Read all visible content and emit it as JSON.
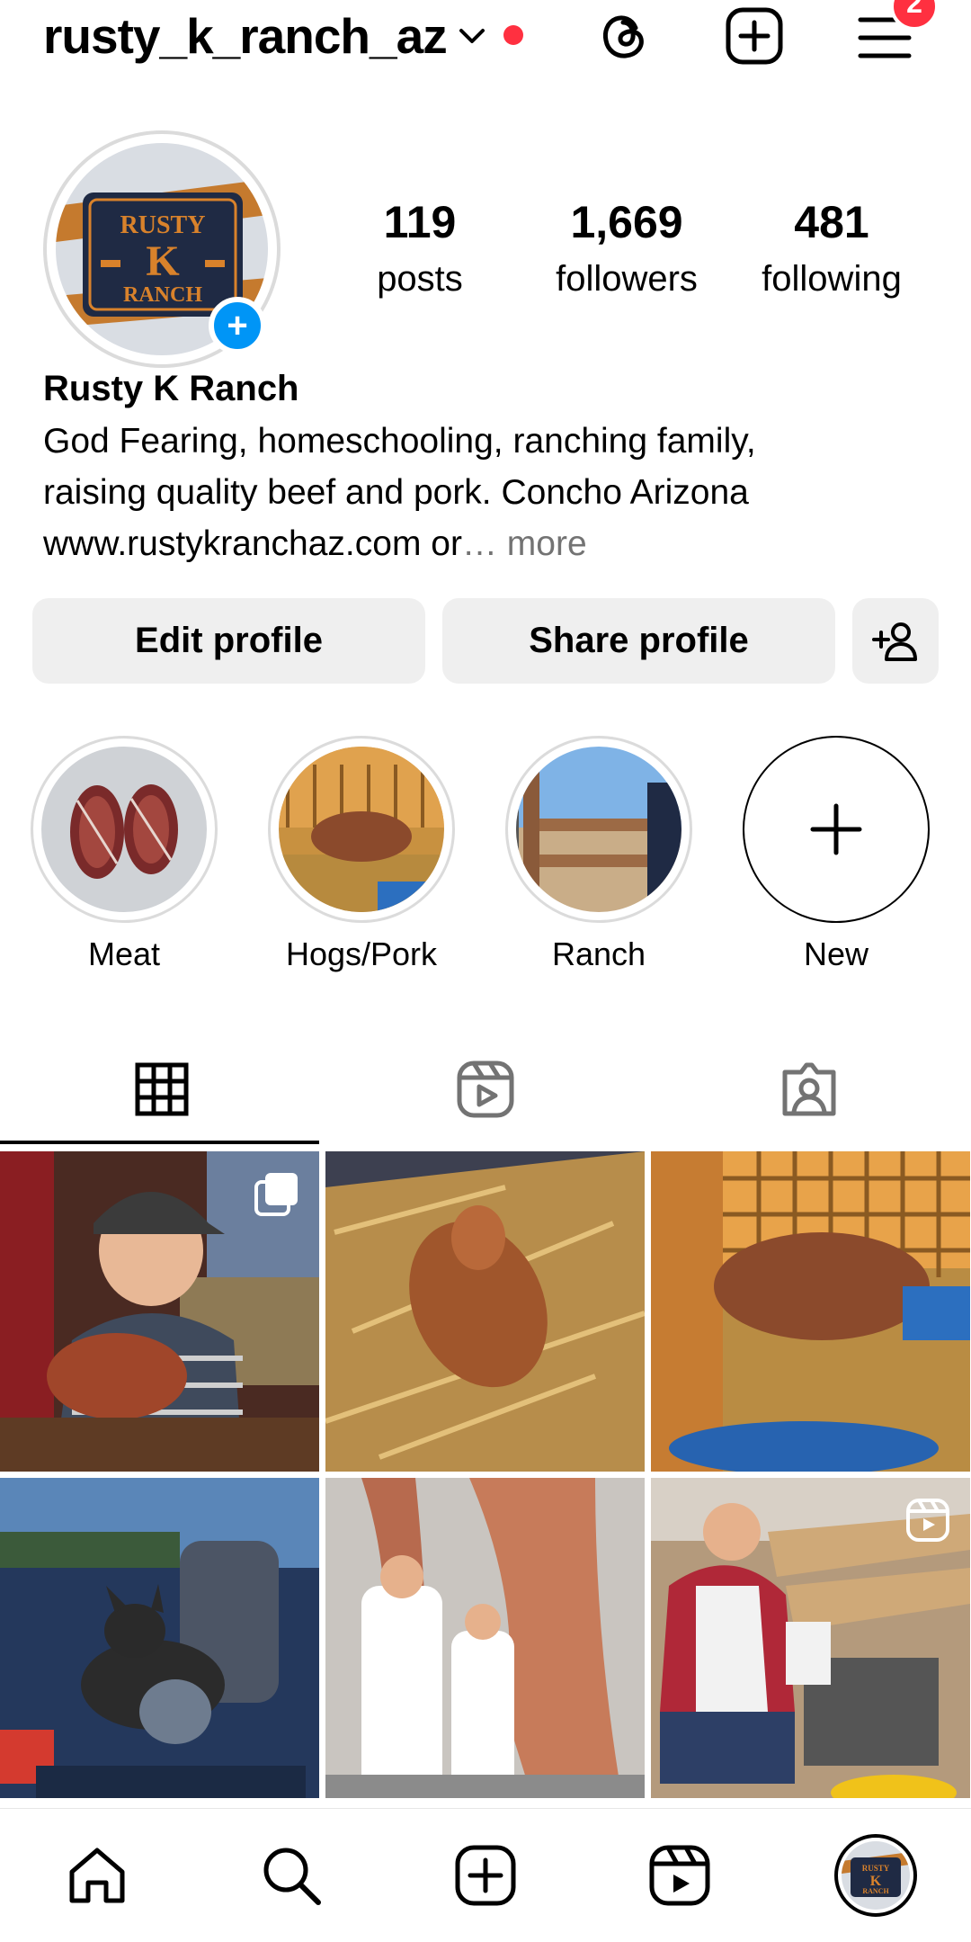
{
  "header": {
    "username": "rusty_k_ranch_az",
    "notification_count": "2"
  },
  "profile": {
    "display_name": "Rusty K Ranch",
    "bio_line1": "God Fearing, homeschooling, ranching family,",
    "bio_line2": "raising quality beef and pork. Concho Arizona",
    "bio_line3": "www.rustykranchaz.com or",
    "bio_more": "… more",
    "logo_text": [
      "RUSTY",
      "K",
      "RANCH"
    ]
  },
  "stats": [
    {
      "value": "119",
      "label": "posts"
    },
    {
      "value": "1,669",
      "label": "followers"
    },
    {
      "value": "481",
      "label": "following"
    }
  ],
  "buttons": {
    "edit_profile": "Edit profile",
    "share_profile": "Share profile"
  },
  "highlights": [
    {
      "label": "Meat"
    },
    {
      "label": "Hogs/Pork"
    },
    {
      "label": "Ranch"
    },
    {
      "label": "New"
    }
  ],
  "tabs": [
    {
      "name": "grid",
      "icon": "grid-icon",
      "active": true
    },
    {
      "name": "reels",
      "icon": "reels-icon",
      "active": false
    },
    {
      "name": "tagged",
      "icon": "tagged-icon",
      "active": false
    }
  ],
  "grid_posts": [
    {
      "description_icon": "carousel-icon"
    },
    {},
    {},
    {},
    {},
    {
      "description_icon": "reel-icon"
    }
  ],
  "bottom_nav": [
    {
      "icon": "home-icon"
    },
    {
      "icon": "search-icon"
    },
    {
      "icon": "create-icon"
    },
    {
      "icon": "reels-icon"
    },
    {
      "icon": "profile-avatar"
    }
  ],
  "colors": {
    "accent_blue": "#0095f6",
    "notification_red": "#ff3040",
    "button_gray": "#efefef",
    "logo_orange": "#d9822b",
    "logo_navy": "#1f2a44"
  }
}
